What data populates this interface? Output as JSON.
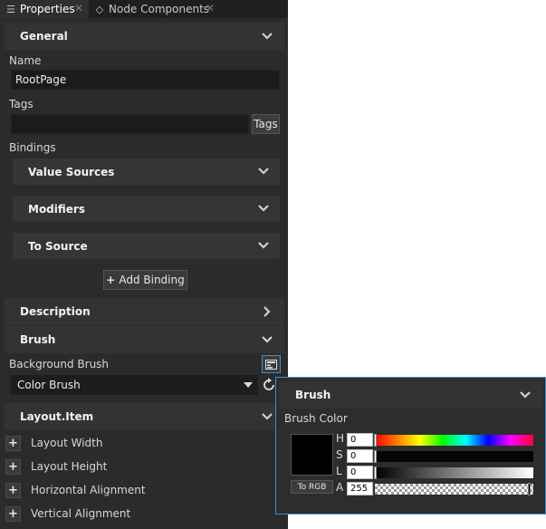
{
  "tabs": [
    {
      "label": "Properties",
      "icon": "list-icon",
      "active": true
    },
    {
      "label": "Node Components",
      "icon": "components-icon",
      "active": false
    }
  ],
  "general": {
    "title": "General",
    "name_label": "Name",
    "name_value": "RootPage",
    "tags_label": "Tags",
    "tags_value": "",
    "tags_button": "Tags",
    "bindings_label": "Bindings",
    "bindings": [
      "Value Sources",
      "Modifiers",
      "To Source"
    ],
    "add_binding": "Add Binding"
  },
  "description": {
    "title": "Description"
  },
  "brush": {
    "title": "Brush",
    "background_label": "Background Brush",
    "brush_type": "Color Brush"
  },
  "layout": {
    "title": "Layout.Item",
    "items": [
      "Layout Width",
      "Layout Height",
      "Horizontal Alignment",
      "Vertical Alignment"
    ]
  },
  "popup": {
    "title": "Brush",
    "color_label": "Brush Color",
    "to_rgb": "To RGB",
    "swatch_color": "#000000",
    "channels": [
      {
        "letter": "H",
        "value": "0"
      },
      {
        "letter": "S",
        "value": "0"
      },
      {
        "letter": "L",
        "value": "0"
      },
      {
        "letter": "A",
        "value": "255"
      }
    ]
  },
  "colors": {
    "panel_bg": "#2b2b2b",
    "header_bg": "#333333",
    "popup_border": "#3d8fd1"
  }
}
